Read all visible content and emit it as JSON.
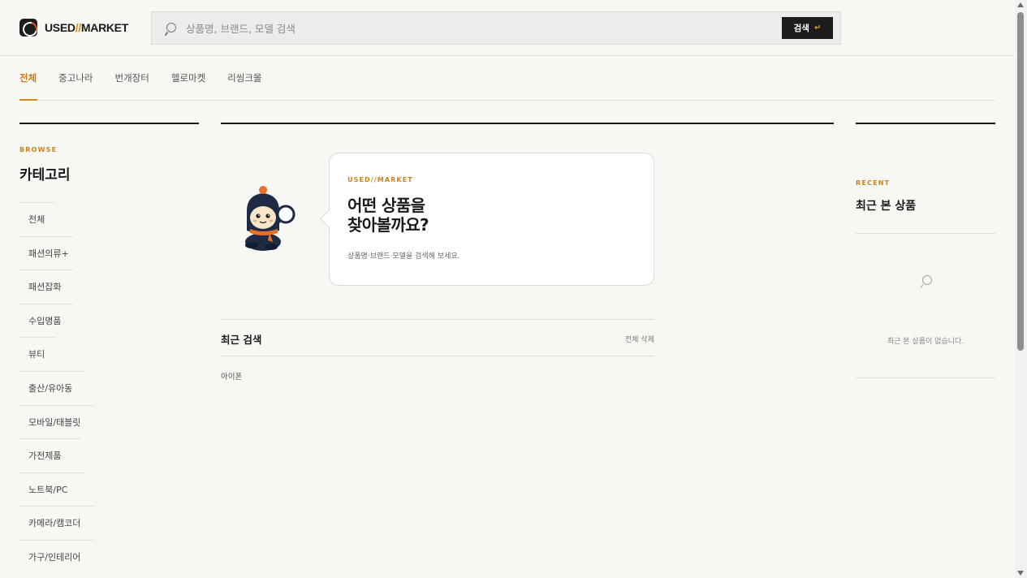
{
  "header": {
    "logo_prefix": "USED",
    "logo_slash": "//",
    "logo_suffix": "MARKET",
    "search_placeholder": "상품명, 브랜드, 모델 검색",
    "search_button": "검색",
    "search_button_icon": "enter-arrow-icon"
  },
  "tabs": [
    {
      "label": "전체",
      "active": true
    },
    {
      "label": "중고나라",
      "active": false
    },
    {
      "label": "번개장터",
      "active": false
    },
    {
      "label": "헬로마켓",
      "active": false
    },
    {
      "label": "리씽크몰",
      "active": false
    }
  ],
  "sidebar": {
    "kicker": "BROWSE",
    "title": "카테고리",
    "items": [
      {
        "label": "전체"
      },
      {
        "label": "패션의류+"
      },
      {
        "label": "패션잡화"
      },
      {
        "label": "수입명품"
      },
      {
        "label": "뷰티"
      },
      {
        "label": "출산/유아동"
      },
      {
        "label": "모바일/태블릿"
      },
      {
        "label": "가전제품"
      },
      {
        "label": "노트북/PC"
      },
      {
        "label": "카메라/캠코더"
      },
      {
        "label": "가구/인테리어"
      }
    ]
  },
  "hero": {
    "kicker": "USED//MARKET",
    "title_line1": "어떤 상품을",
    "title_line2": "찾아볼까요?",
    "subtitle": "상품명·브랜드·모델을 검색해 보세요.",
    "mascot_icon": "mascot-magnifier-icon"
  },
  "recent_search": {
    "title": "최근 검색",
    "clear_label": "전체 삭제",
    "items": [
      "아이폰"
    ]
  },
  "recent_viewed": {
    "kicker": "RECENT",
    "title": "최근 본 상품",
    "empty_text": "최근 본 상품이 없습니다.",
    "empty_icon": "search-icon"
  },
  "colors": {
    "accent": "#d88a17",
    "background": "#f7f7f4",
    "dark": "#1c1c1c",
    "mascot_navy": "#1f2a44",
    "mascot_orange": "#e8712a"
  }
}
